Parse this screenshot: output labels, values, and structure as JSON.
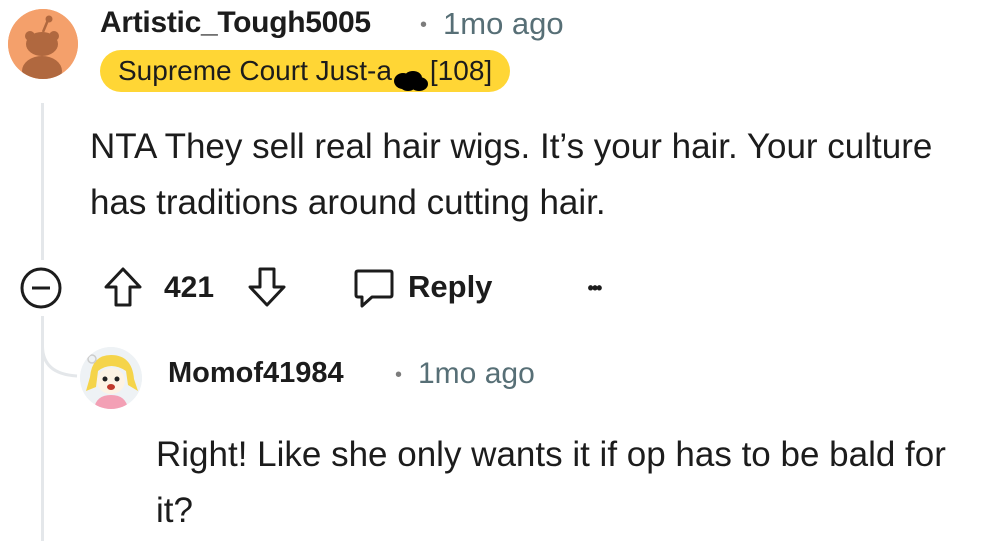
{
  "comment": {
    "username": "Artistic_Tough5005",
    "separator": "•",
    "time": "1mo ago",
    "flair_prefix": "Supreme Court Just-a",
    "flair_suffix": "[108]",
    "body": "NTA They sell real hair wigs. It’s your hair. Your culture has traditions around cutting hair.",
    "votes": "421",
    "reply_label": "Reply",
    "more_label": "•••",
    "collapse_icon": "minus-circle-icon",
    "upvote_icon": "arrow-up-icon",
    "downvote_icon": "arrow-down-icon",
    "reply_icon": "speech-bubble-icon"
  },
  "reply": {
    "username": "Momof41984",
    "separator": "•",
    "time": "1mo ago",
    "body": "Right! Like she only wants it if op has to be bald for it?"
  },
  "colors": {
    "flair_bg": "#ffd635",
    "avatar1_bg": "#f4a06b",
    "thread_line": "#e4e7ea",
    "meta_text": "#576f76"
  }
}
